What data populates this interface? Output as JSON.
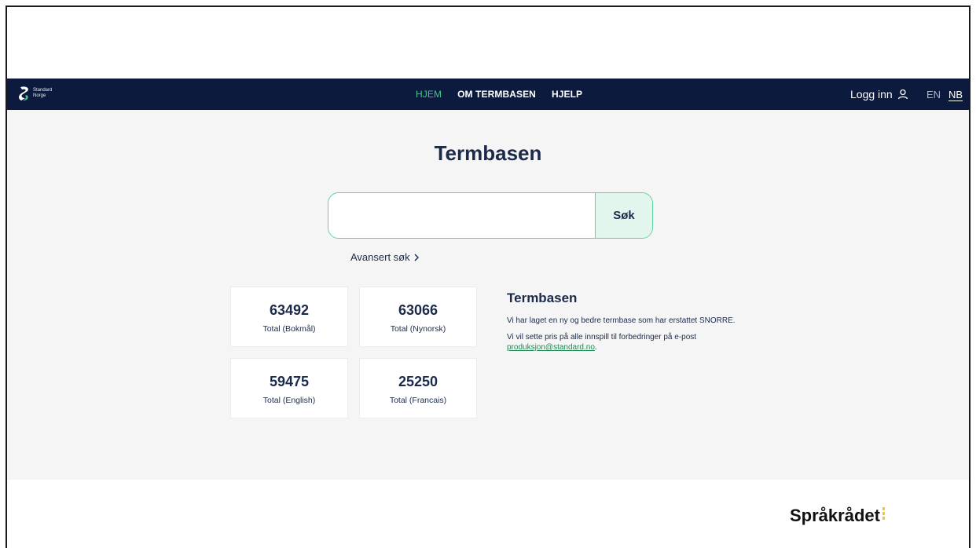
{
  "brand": {
    "logo_line1": "Standard",
    "logo_line2": "Norge"
  },
  "nav": {
    "items": [
      {
        "label": "HJEM",
        "active": true
      },
      {
        "label": "OM TERMBASEN",
        "active": false
      },
      {
        "label": "HJELP",
        "active": false
      }
    ],
    "login_label": "Logg inn",
    "languages": [
      {
        "code": "EN",
        "selected": false
      },
      {
        "code": "NB",
        "selected": true
      }
    ]
  },
  "page": {
    "title": "Termbasen"
  },
  "search": {
    "value": "",
    "placeholder": "",
    "button_label": "Søk",
    "advanced_label": "Avansert søk"
  },
  "stats": [
    {
      "value": "63492",
      "label": "Total (Bokmål)"
    },
    {
      "value": "63066",
      "label": "Total (Nynorsk)"
    },
    {
      "value": "59475",
      "label": "Total (English)"
    },
    {
      "value": "25250",
      "label": "Total (Francais)"
    }
  ],
  "info": {
    "title": "Termbasen",
    "paragraph1": "Vi har laget en ny og bedre termbase som har erstattet SNORRE.",
    "paragraph2_prefix": "Vi vil sette pris på alle innspill til forbedringer på e-post ",
    "email": "produksjon@standard.no",
    "paragraph2_suffix": "."
  },
  "footer": {
    "logo_text": "Språkrådet"
  },
  "colors": {
    "navbar": "#0c1a3d",
    "accent": "#3ec98b",
    "heading": "#1b2a4a",
    "background": "#f5f5f5"
  }
}
